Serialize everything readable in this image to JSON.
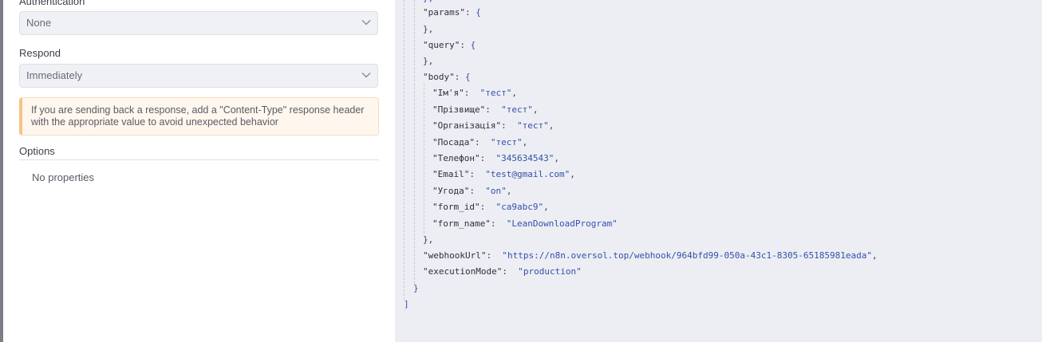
{
  "form": {
    "authentication": {
      "label": "Authentication",
      "value": "None"
    },
    "respond": {
      "label": "Respond",
      "value": "Immediately"
    },
    "notice": "If you are sending back a response, add a \"Content-Type\" response header with the appropriate value to avoid unexpected behavior",
    "options": {
      "title": "Options",
      "empty": "No properties"
    }
  },
  "output": {
    "top_brace": "},",
    "params_key": "\"params\"",
    "query_key": "\"query\"",
    "body_key": "\"body\"",
    "close_comma": "},",
    "fields": [
      {
        "key": "\"Ім'я\"",
        "value": "\"тест\"",
        "comma": ","
      },
      {
        "key": "\"Прізвище\"",
        "value": "\"тест\"",
        "comma": ","
      },
      {
        "key": "\"Організація\"",
        "value": "\"тест\"",
        "comma": ","
      },
      {
        "key": "\"Посада\"",
        "value": "\"тест\"",
        "comma": ","
      },
      {
        "key": "\"Телефон\"",
        "value": "\"345634543\"",
        "comma": ","
      },
      {
        "key": "\"Email\"",
        "value": "\"test@gmail.com\"",
        "comma": ","
      },
      {
        "key": "\"Угода\"",
        "value": "\"on\"",
        "comma": ","
      },
      {
        "key": "\"form_id\"",
        "value": "\"ca9abc9\"",
        "comma": ","
      },
      {
        "key": "\"form_name\"",
        "value": "\"LeanDownloadProgram\"",
        "comma": ""
      }
    ],
    "webhook": {
      "key": "\"webhookUrl\"",
      "value": "\"https://n8n.oversol.top/webhook/964bfd99-050a-43c1-8305-65185981eada\"",
      "comma": ","
    },
    "execution": {
      "key": "\"executionMode\"",
      "value": "\"production\""
    },
    "obj_close": "}",
    "arr_close": "]"
  },
  "icons": {
    "select_arrow": "chevron-down-icon"
  }
}
